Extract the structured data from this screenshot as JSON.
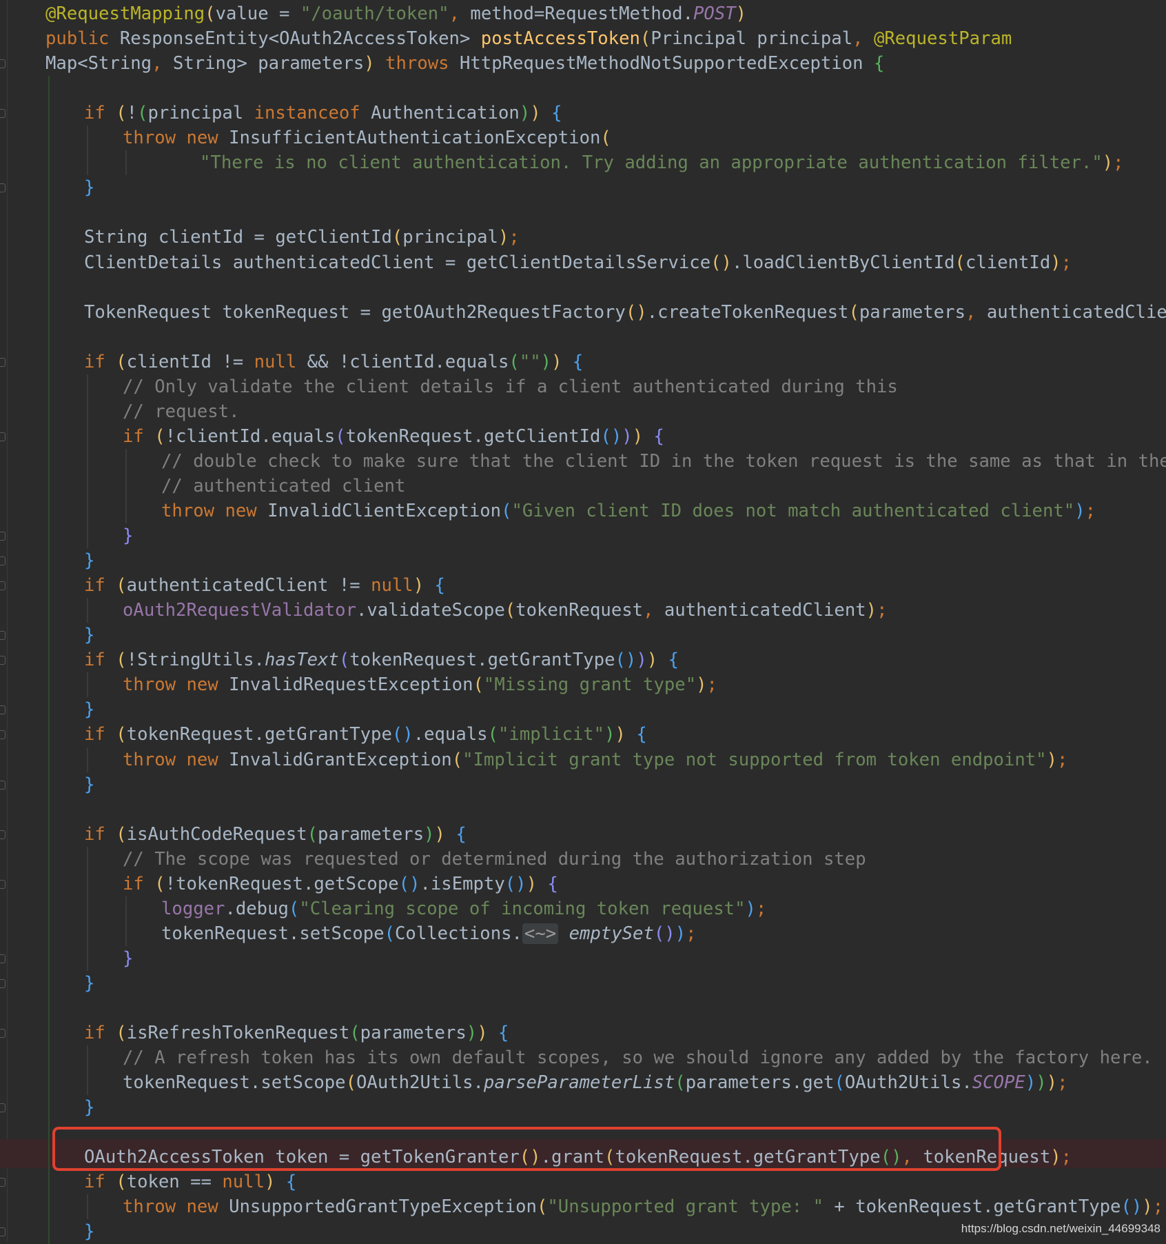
{
  "editor": {
    "highlighted_line_index": 45,
    "lines": [
      {
        "indent": 0,
        "tokens": [
          [
            "@RequestMapping",
            "ann"
          ],
          [
            "(",
            "p1"
          ],
          [
            "value",
            ""
          ],
          [
            " = ",
            ""
          ],
          [
            "\"/oauth/token\"",
            "str"
          ],
          [
            ", ",
            "kw"
          ],
          [
            "method",
            ""
          ],
          [
            "=",
            ""
          ],
          [
            "RequestMethod.",
            ""
          ],
          [
            "POST",
            "ifld"
          ],
          [
            ")",
            "p1"
          ]
        ]
      },
      {
        "indent": 0,
        "tokens": [
          [
            "public ",
            "kw"
          ],
          [
            "ResponseEntity<OAuth2AccessToken> ",
            ""
          ],
          [
            "postAccessToken",
            "mth"
          ],
          [
            "(",
            "p1"
          ],
          [
            "Principal principal",
            ""
          ],
          [
            ", ",
            "kw"
          ],
          [
            "@RequestParam",
            "ann"
          ]
        ]
      },
      {
        "indent": 0,
        "tokens": [
          [
            "Map<String",
            ""
          ],
          [
            ", ",
            "kw"
          ],
          [
            "String> parameters",
            ""
          ],
          [
            ") ",
            "p1"
          ],
          [
            "throws ",
            "kw"
          ],
          [
            "HttpRequestMethodNotSupportedException ",
            ""
          ],
          [
            "{",
            "p4"
          ]
        ]
      },
      {
        "indent": 0,
        "tokens": []
      },
      {
        "indent": 1,
        "tokens": [
          [
            "if ",
            "kw"
          ],
          [
            "(",
            "p1"
          ],
          [
            "!",
            ""
          ],
          [
            "(",
            "p4"
          ],
          [
            "principal ",
            ""
          ],
          [
            "instanceof ",
            "kw"
          ],
          [
            "Authentication",
            ""
          ],
          [
            ")",
            "p4"
          ],
          [
            ")",
            "p1"
          ],
          [
            " ",
            ""
          ],
          [
            "{",
            "p3"
          ]
        ]
      },
      {
        "indent": 2,
        "tokens": [
          [
            "throw new ",
            "kw"
          ],
          [
            "InsufficientAuthenticationException",
            ""
          ],
          [
            "(",
            "p1"
          ]
        ]
      },
      {
        "indent": 4,
        "tokens": [
          [
            "\"There is no client authentication. Try adding an appropriate authentication filter.\"",
            "str"
          ],
          [
            ")",
            "p1"
          ],
          [
            ";",
            "kw"
          ]
        ]
      },
      {
        "indent": 1,
        "tokens": [
          [
            "}",
            "p3"
          ]
        ]
      },
      {
        "indent": 0,
        "tokens": []
      },
      {
        "indent": 1,
        "tokens": [
          [
            "String clientId = getClientId",
            ""
          ],
          [
            "(",
            "p1"
          ],
          [
            "principal",
            ""
          ],
          [
            ")",
            "p1"
          ],
          [
            ";",
            "kw"
          ]
        ]
      },
      {
        "indent": 1,
        "tokens": [
          [
            "ClientDetails authenticatedClient = getClientDetailsService",
            ""
          ],
          [
            "()",
            "p1"
          ],
          [
            ".loadClientByClientId",
            ""
          ],
          [
            "(",
            "p1"
          ],
          [
            "clientId",
            ""
          ],
          [
            ")",
            "p1"
          ],
          [
            ";",
            "kw"
          ]
        ]
      },
      {
        "indent": 0,
        "tokens": []
      },
      {
        "indent": 1,
        "tokens": [
          [
            "TokenRequest tokenRequest = getOAuth2RequestFactory",
            ""
          ],
          [
            "()",
            "p1"
          ],
          [
            ".createTokenRequest",
            ""
          ],
          [
            "(",
            "p1"
          ],
          [
            "parameters",
            ""
          ],
          [
            ", ",
            "kw"
          ],
          [
            "authenticatedClient",
            ""
          ],
          [
            ")",
            "p1"
          ],
          [
            ";",
            "kw"
          ]
        ]
      },
      {
        "indent": 0,
        "tokens": []
      },
      {
        "indent": 1,
        "tokens": [
          [
            "if ",
            "kw"
          ],
          [
            "(",
            "p1"
          ],
          [
            "clientId != ",
            ""
          ],
          [
            "null ",
            "kw"
          ],
          [
            "&& !clientId.equals",
            ""
          ],
          [
            "(",
            "p4"
          ],
          [
            "\"\"",
            "str"
          ],
          [
            ")",
            "p4"
          ],
          [
            ")",
            "p1"
          ],
          [
            " ",
            ""
          ],
          [
            "{",
            "p3"
          ]
        ]
      },
      {
        "indent": 2,
        "tokens": [
          [
            "// Only validate the client details if a client authenticated during this",
            "cmt"
          ]
        ]
      },
      {
        "indent": 2,
        "tokens": [
          [
            "// request.",
            "cmt"
          ]
        ]
      },
      {
        "indent": 2,
        "tokens": [
          [
            "if ",
            "kw"
          ],
          [
            "(",
            "p1"
          ],
          [
            "!clientId.equals",
            ""
          ],
          [
            "(",
            "p2"
          ],
          [
            "tokenRequest.getClientId",
            ""
          ],
          [
            "()",
            "p3"
          ],
          [
            ")",
            "p2"
          ],
          [
            ")",
            "p1"
          ],
          [
            " ",
            ""
          ],
          [
            "{",
            "p2"
          ]
        ]
      },
      {
        "indent": 3,
        "tokens": [
          [
            "// double check to make sure that the client ID in the token request is the same as that in the",
            "cmt"
          ]
        ]
      },
      {
        "indent": 3,
        "tokens": [
          [
            "// authenticated client",
            "cmt"
          ]
        ]
      },
      {
        "indent": 3,
        "tokens": [
          [
            "throw new ",
            "kw"
          ],
          [
            "InvalidClientException",
            ""
          ],
          [
            "(",
            "p3"
          ],
          [
            "\"Given client ID does not match authenticated client\"",
            "str"
          ],
          [
            ")",
            "p3"
          ],
          [
            ";",
            "kw"
          ]
        ]
      },
      {
        "indent": 2,
        "tokens": [
          [
            "}",
            "p2"
          ]
        ]
      },
      {
        "indent": 1,
        "tokens": [
          [
            "}",
            "p3"
          ]
        ]
      },
      {
        "indent": 1,
        "tokens": [
          [
            "if ",
            "kw"
          ],
          [
            "(",
            "p1"
          ],
          [
            "authenticatedClient != ",
            ""
          ],
          [
            "null",
            "kw"
          ],
          [
            ")",
            "p1"
          ],
          [
            " ",
            ""
          ],
          [
            "{",
            "p3"
          ]
        ]
      },
      {
        "indent": 2,
        "tokens": [
          [
            "oAuth2RequestValidator",
            "fld"
          ],
          [
            ".validateScope",
            ""
          ],
          [
            "(",
            "p1"
          ],
          [
            "tokenRequest",
            ""
          ],
          [
            ", ",
            "kw"
          ],
          [
            "authenticatedClient",
            ""
          ],
          [
            ")",
            "p1"
          ],
          [
            ";",
            "kw"
          ]
        ]
      },
      {
        "indent": 1,
        "tokens": [
          [
            "}",
            "p3"
          ]
        ]
      },
      {
        "indent": 1,
        "tokens": [
          [
            "if ",
            "kw"
          ],
          [
            "(",
            "p1"
          ],
          [
            "!StringUtils.",
            ""
          ],
          [
            "hasText",
            "ital"
          ],
          [
            "(",
            "p2"
          ],
          [
            "tokenRequest.getGrantType",
            ""
          ],
          [
            "()",
            "p3"
          ],
          [
            ")",
            "p2"
          ],
          [
            ")",
            "p1"
          ],
          [
            " ",
            ""
          ],
          [
            "{",
            "p3"
          ]
        ]
      },
      {
        "indent": 2,
        "tokens": [
          [
            "throw new ",
            "kw"
          ],
          [
            "InvalidRequestException",
            ""
          ],
          [
            "(",
            "p1"
          ],
          [
            "\"Missing grant type\"",
            "str"
          ],
          [
            ")",
            "p1"
          ],
          [
            ";",
            "kw"
          ]
        ]
      },
      {
        "indent": 1,
        "tokens": [
          [
            "}",
            "p3"
          ]
        ]
      },
      {
        "indent": 1,
        "tokens": [
          [
            "if ",
            "kw"
          ],
          [
            "(",
            "p1"
          ],
          [
            "tokenRequest.getGrantType",
            ""
          ],
          [
            "()",
            "p3"
          ],
          [
            ".equals",
            ""
          ],
          [
            "(",
            "p4"
          ],
          [
            "\"implicit\"",
            "str"
          ],
          [
            ")",
            "p4"
          ],
          [
            ")",
            "p1"
          ],
          [
            " ",
            ""
          ],
          [
            "{",
            "p3"
          ]
        ]
      },
      {
        "indent": 2,
        "tokens": [
          [
            "throw new ",
            "kw"
          ],
          [
            "InvalidGrantException",
            ""
          ],
          [
            "(",
            "p1"
          ],
          [
            "\"Implicit grant type not supported from token endpoint\"",
            "str"
          ],
          [
            ")",
            "p1"
          ],
          [
            ";",
            "kw"
          ]
        ]
      },
      {
        "indent": 1,
        "tokens": [
          [
            "}",
            "p3"
          ]
        ]
      },
      {
        "indent": 0,
        "tokens": []
      },
      {
        "indent": 1,
        "tokens": [
          [
            "if ",
            "kw"
          ],
          [
            "(",
            "p1"
          ],
          [
            "isAuthCodeRequest",
            ""
          ],
          [
            "(",
            "p4"
          ],
          [
            "parameters",
            ""
          ],
          [
            ")",
            "p4"
          ],
          [
            ")",
            "p1"
          ],
          [
            " ",
            ""
          ],
          [
            "{",
            "p3"
          ]
        ]
      },
      {
        "indent": 2,
        "tokens": [
          [
            "// The scope was requested or determined during the authorization step",
            "cmt"
          ]
        ]
      },
      {
        "indent": 2,
        "tokens": [
          [
            "if ",
            "kw"
          ],
          [
            "(",
            "p1"
          ],
          [
            "!tokenRequest.getScope",
            ""
          ],
          [
            "()",
            "p3"
          ],
          [
            ".isEmpty",
            ""
          ],
          [
            "()",
            "p3"
          ],
          [
            ")",
            "p1"
          ],
          [
            " ",
            ""
          ],
          [
            "{",
            "p2"
          ]
        ]
      },
      {
        "indent": 3,
        "tokens": [
          [
            "logger",
            "fld"
          ],
          [
            ".debug",
            ""
          ],
          [
            "(",
            "p3"
          ],
          [
            "\"Clearing scope of incoming token request\"",
            "str"
          ],
          [
            ")",
            "p3"
          ],
          [
            ";",
            "kw"
          ]
        ]
      },
      {
        "indent": 3,
        "tokens": [
          [
            "tokenRequest.setScope",
            ""
          ],
          [
            "(",
            "p3"
          ],
          [
            "Collections.",
            ""
          ],
          [
            "<~>",
            "diam"
          ],
          [
            " ",
            ""
          ],
          [
            "emptySet",
            "ital"
          ],
          [
            "()",
            "p2"
          ],
          [
            ")",
            "p3"
          ],
          [
            ";",
            "kw"
          ]
        ]
      },
      {
        "indent": 2,
        "tokens": [
          [
            "}",
            "p2"
          ]
        ]
      },
      {
        "indent": 1,
        "tokens": [
          [
            "}",
            "p3"
          ]
        ]
      },
      {
        "indent": 0,
        "tokens": []
      },
      {
        "indent": 1,
        "tokens": [
          [
            "if ",
            "kw"
          ],
          [
            "(",
            "p1"
          ],
          [
            "isRefreshTokenRequest",
            ""
          ],
          [
            "(",
            "p4"
          ],
          [
            "parameters",
            ""
          ],
          [
            ")",
            "p4"
          ],
          [
            ")",
            "p1"
          ],
          [
            " ",
            ""
          ],
          [
            "{",
            "p3"
          ]
        ]
      },
      {
        "indent": 2,
        "tokens": [
          [
            "// A refresh token has its own default scopes, so we should ignore any added by the factory here.",
            "cmt"
          ]
        ]
      },
      {
        "indent": 2,
        "tokens": [
          [
            "tokenRequest.setScope",
            ""
          ],
          [
            "(",
            "p1"
          ],
          [
            "OAuth2Utils.",
            ""
          ],
          [
            "parseParameterList",
            "ital"
          ],
          [
            "(",
            "p4"
          ],
          [
            "parameters.get",
            ""
          ],
          [
            "(",
            "p3"
          ],
          [
            "OAuth2Utils.",
            ""
          ],
          [
            "SCOPE",
            "ifld"
          ],
          [
            ")",
            "p3"
          ],
          [
            ")",
            "p4"
          ],
          [
            ")",
            "p1"
          ],
          [
            ";",
            "kw"
          ]
        ]
      },
      {
        "indent": 1,
        "tokens": [
          [
            "}",
            "p3"
          ]
        ]
      },
      {
        "indent": 0,
        "tokens": []
      },
      {
        "indent": 1,
        "tokens": [
          [
            "OAuth2AccessToken token = getTokenGranter",
            ""
          ],
          [
            "()",
            "p1"
          ],
          [
            ".grant",
            ""
          ],
          [
            "(",
            "p1"
          ],
          [
            "tokenRequest.getGrantType",
            ""
          ],
          [
            "()",
            "p4"
          ],
          [
            ", ",
            "kw"
          ],
          [
            "tokenRequest",
            ""
          ],
          [
            ")",
            "p1"
          ],
          [
            ";",
            "kw"
          ]
        ]
      },
      {
        "indent": 1,
        "tokens": [
          [
            "if ",
            "kw"
          ],
          [
            "(",
            "p1"
          ],
          [
            "token == ",
            ""
          ],
          [
            "null",
            "kw"
          ],
          [
            ")",
            "p1"
          ],
          [
            " ",
            ""
          ],
          [
            "{",
            "p3"
          ]
        ]
      },
      {
        "indent": 2,
        "tokens": [
          [
            "throw new ",
            "kw"
          ],
          [
            "UnsupportedGrantTypeException",
            ""
          ],
          [
            "(",
            "p1"
          ],
          [
            "\"Unsupported grant type: \" ",
            "str"
          ],
          [
            "+ tokenRequest.getGrantType",
            ""
          ],
          [
            "()",
            "p3"
          ],
          [
            ")",
            "p1"
          ],
          [
            ";",
            "kw"
          ]
        ]
      },
      {
        "indent": 1,
        "tokens": [
          [
            "}",
            "p3"
          ]
        ]
      }
    ]
  },
  "watermark": "https://blog.csdn.net/weixin_44699348",
  "colors": {
    "background": "#2b2b2b",
    "keyword": "#cc7832",
    "string": "#6a8759",
    "comment": "#808080",
    "annotation": "#bbb529",
    "highlight_box": "#e0412f"
  }
}
